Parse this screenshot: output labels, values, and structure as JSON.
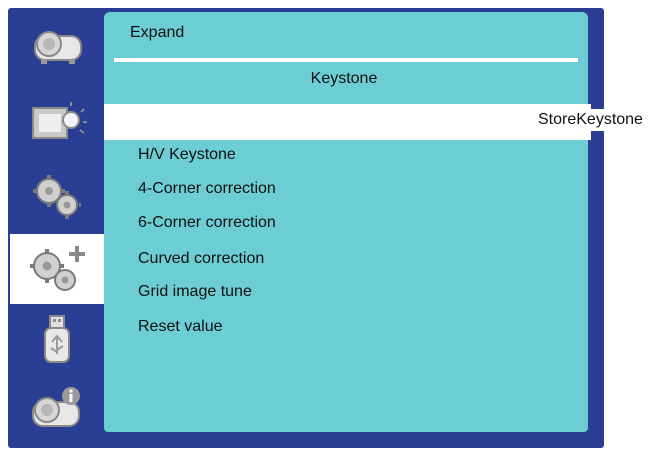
{
  "panel": {
    "title": "Expand",
    "subtitle": "Keystone",
    "highlighted_label": "StoreKeystone",
    "items": [
      {
        "label": "H/V Keystone"
      },
      {
        "label": "4-Corner correction"
      },
      {
        "label": "6-Corner correction"
      },
      {
        "label": "Curved correction"
      },
      {
        "label": "Grid image tune"
      },
      {
        "label": "Reset value"
      }
    ]
  },
  "sidebar": {
    "items": [
      {
        "icon": "projector-icon",
        "selected": false
      },
      {
        "icon": "display-brightness-icon",
        "selected": false
      },
      {
        "icon": "gear-icon",
        "selected": false
      },
      {
        "icon": "gear-plus-icon",
        "selected": true
      },
      {
        "icon": "usb-drive-icon",
        "selected": false
      },
      {
        "icon": "projector-info-icon",
        "selected": false
      }
    ]
  },
  "colors": {
    "frame": "#2a3f93",
    "panel": "#6dcdd4",
    "highlight": "#ffffff"
  }
}
